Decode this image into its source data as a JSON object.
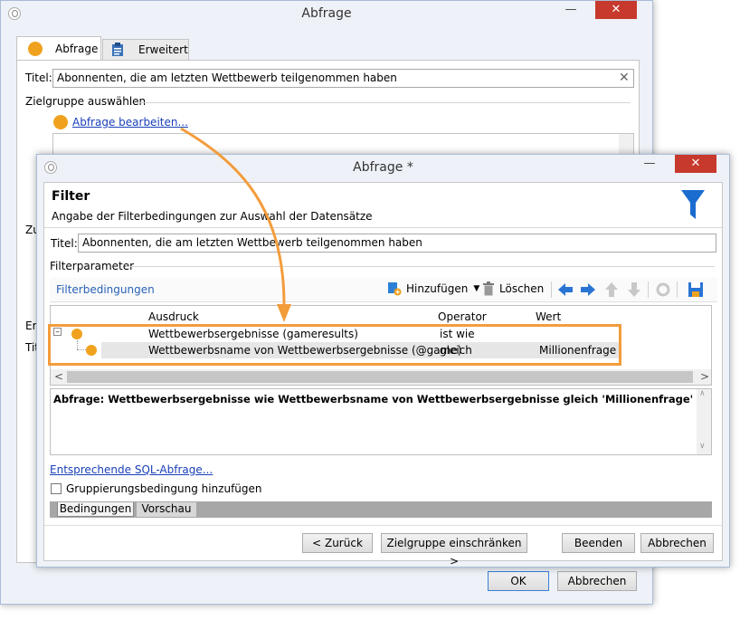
{
  "back_window": {
    "title": "Abfrage",
    "tabs": [
      {
        "label": "Abfrage"
      },
      {
        "label": "Erweitert"
      }
    ],
    "title_label": "Titel:",
    "title_value": "Abonnenten, die am letzten Wettbewerb teilgenommen haben",
    "target_group_label": "Zielgruppe auswählen",
    "edit_query_link": "Abfrage bearbeiten...",
    "partial_labels": [
      "Zu",
      "Erg",
      "Tit"
    ],
    "ok_label": "OK",
    "cancel_label": "Abbrechen"
  },
  "front_window": {
    "title": "Abfrage *",
    "header_title": "Filter",
    "header_subtitle": "Angabe der Filterbedingungen zur Auswahl der Datensätze",
    "title_label": "Titel:",
    "title_value": "Abonnenten, die am letzten Wettbewerb teilgenommen haben",
    "filter_params_label": "Filterparameter",
    "toolbar": {
      "section_label": "Filterbedingungen",
      "add_label": "Hinzufügen",
      "delete_label": "Löschen"
    },
    "grid": {
      "columns": [
        "Ausdruck",
        "Operator",
        "Wert"
      ],
      "rows": [
        {
          "expression": "Wettbewerbsergebnisse (gameresults)",
          "operator": "ist wie",
          "value": ""
        },
        {
          "expression": "Wettbewerbsname von Wettbewerbsergebnisse (@game)",
          "operator": "gleich",
          "value": "Millionenfrage"
        }
      ]
    },
    "query_text": "Abfrage: Wettbewerbsergebnisse wie Wettbewerbsname von Wettbewerbsergebnisse gleich 'Millionenfrage'",
    "sql_link": "Entsprechende SQL-Abfrage...",
    "grouping_label": "Gruppierungsbedingung hinzufügen",
    "bottom_tabs": [
      {
        "label": "Bedingungen"
      },
      {
        "label": "Vorschau"
      }
    ],
    "buttons": {
      "back": "< Zurück",
      "restrict": "Zielgruppe einschränken >",
      "finish": "Beenden",
      "cancel": "Abbrechen"
    }
  },
  "colors": {
    "accent_orange": "#f0a21e",
    "highlight_border": "#f39c3c",
    "close_red": "#c7392c",
    "link_blue": "#1a3fb8",
    "toolbar_blue": "#2c7fd6"
  }
}
